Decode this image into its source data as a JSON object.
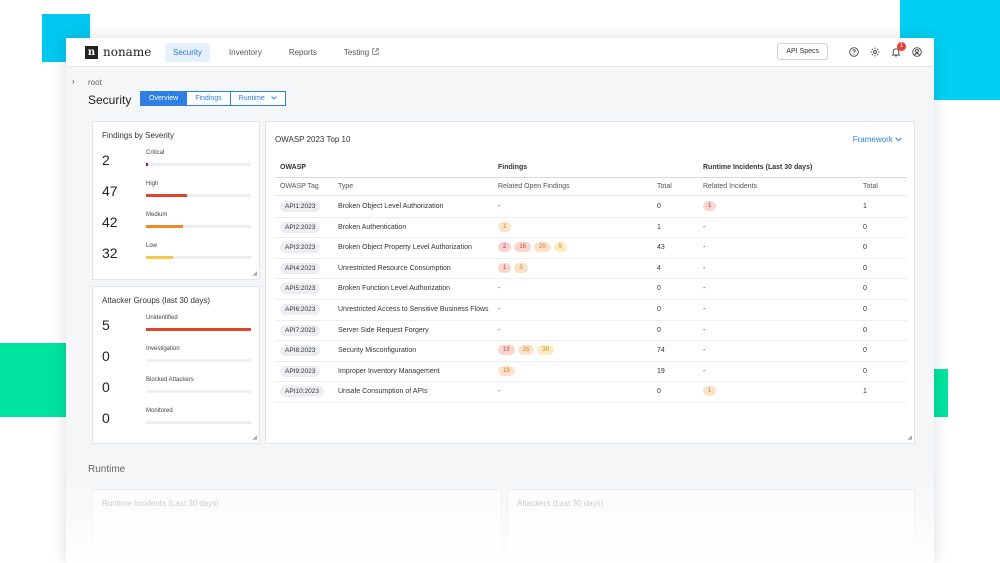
{
  "app": {
    "logo_text": "noname",
    "logo_mark": "n"
  },
  "nav": [
    {
      "label": "Security",
      "active": true
    },
    {
      "label": "Inventory",
      "active": false
    },
    {
      "label": "Reports",
      "active": false
    },
    {
      "label": "Testing",
      "active": false
    }
  ],
  "topbar": {
    "api_specs_label": "API Specs",
    "notification_count": "1"
  },
  "breadcrumb": "root",
  "page_title": "Security",
  "view_tabs": [
    "Overview",
    "Findings",
    "Runtime"
  ],
  "severity_card": {
    "title": "Findings by Severity",
    "items": [
      {
        "count": "2",
        "label": "Critical",
        "fraction": 0.02,
        "color": "#c8102e"
      },
      {
        "count": "47",
        "label": "High",
        "fraction": 0.39,
        "color": "#e2452e"
      },
      {
        "count": "42",
        "label": "Medium",
        "fraction": 0.35,
        "color": "#f08a24"
      },
      {
        "count": "32",
        "label": "Low",
        "fraction": 0.26,
        "color": "#f7c948"
      }
    ]
  },
  "attacker_card": {
    "title": "Attacker Groups (last 30 days)",
    "items": [
      {
        "count": "5",
        "label": "Unidentified",
        "fraction": 1.0,
        "color": "#e2452e"
      },
      {
        "count": "0",
        "label": "Investigation",
        "fraction": 0,
        "color": "#f08a24"
      },
      {
        "count": "0",
        "label": "Blocked Attackers",
        "fraction": 0,
        "color": "#f08a24"
      },
      {
        "count": "0",
        "label": "Monitored",
        "fraction": 0,
        "color": "#f08a24"
      }
    ]
  },
  "owasp": {
    "title": "OWASP 2023 Top 10",
    "framework_label": "Framework",
    "group_headers": {
      "owasp": "OWASP",
      "findings": "Findings",
      "runtime": "Runtime Incidents (Last 30 days)"
    },
    "columns": {
      "tag": "OWASP Tag",
      "type": "Type",
      "related": "Related Open Findings",
      "total": "Total",
      "related_incidents": "Related Incidents",
      "runtime_total": "Total"
    },
    "rows": [
      {
        "tag": "API1:2023",
        "type": "Broken Object Level Authorization",
        "findings": [],
        "findings_text": "-",
        "total": "0",
        "incidents": [
          {
            "value": "1",
            "sev": "high"
          }
        ],
        "incidents_text": "",
        "runtime_total": "1"
      },
      {
        "tag": "API2:2023",
        "type": "Broken Authentication",
        "findings": [
          {
            "value": "1",
            "sev": "medium"
          }
        ],
        "findings_text": "",
        "total": "1",
        "incidents": [],
        "incidents_text": "-",
        "runtime_total": "0"
      },
      {
        "tag": "API3:2023",
        "type": "Broken Object Property Level Authorization",
        "findings": [
          {
            "value": "2",
            "sev": "critical"
          },
          {
            "value": "16",
            "sev": "high"
          },
          {
            "value": "20",
            "sev": "medium"
          },
          {
            "value": "5",
            "sev": "low"
          }
        ],
        "findings_text": "",
        "total": "43",
        "incidents": [],
        "incidents_text": "-",
        "runtime_total": "0"
      },
      {
        "tag": "API4:2023",
        "type": "Unrestricted Resource Consumption",
        "findings": [
          {
            "value": "1",
            "sev": "high"
          },
          {
            "value": "3",
            "sev": "medium"
          }
        ],
        "findings_text": "",
        "total": "4",
        "incidents": [],
        "incidents_text": "-",
        "runtime_total": "0"
      },
      {
        "tag": "API5:2023",
        "type": "Broken Function Level Authorization",
        "findings": [],
        "findings_text": "-",
        "total": "0",
        "incidents": [],
        "incidents_text": "-",
        "runtime_total": "0"
      },
      {
        "tag": "API6:2023",
        "type": "Unrestricted Access to Sensitive Business Flows",
        "findings": [],
        "findings_text": "-",
        "total": "0",
        "incidents": [],
        "incidents_text": "-",
        "runtime_total": "0"
      },
      {
        "tag": "API7:2023",
        "type": "Server Side Request Forgery",
        "findings": [],
        "findings_text": "-",
        "total": "0",
        "incidents": [],
        "incidents_text": "-",
        "runtime_total": "0"
      },
      {
        "tag": "API8:2023",
        "type": "Security Misconfiguration",
        "findings": [
          {
            "value": "19",
            "sev": "high"
          },
          {
            "value": "25",
            "sev": "medium"
          },
          {
            "value": "30",
            "sev": "low"
          }
        ],
        "findings_text": "",
        "total": "74",
        "incidents": [],
        "incidents_text": "-",
        "runtime_total": "0"
      },
      {
        "tag": "API9:2023",
        "type": "Improper Inventory Management",
        "findings": [
          {
            "value": "19",
            "sev": "medium"
          }
        ],
        "findings_text": "",
        "total": "19",
        "incidents": [],
        "incidents_text": "-",
        "runtime_total": "0"
      },
      {
        "tag": "API10:2023",
        "type": "Unsafe Consumption of APIs",
        "findings": [],
        "findings_text": "-",
        "total": "0",
        "incidents": [
          {
            "value": "1",
            "sev": "medium"
          }
        ],
        "incidents_text": "",
        "runtime_total": "1"
      }
    ]
  },
  "runtime": {
    "title": "Runtime",
    "incidents_card_title": "Runtime Incidents (Last 30 days)",
    "attackers_card_title": "Attackers (Last 30 days)"
  }
}
